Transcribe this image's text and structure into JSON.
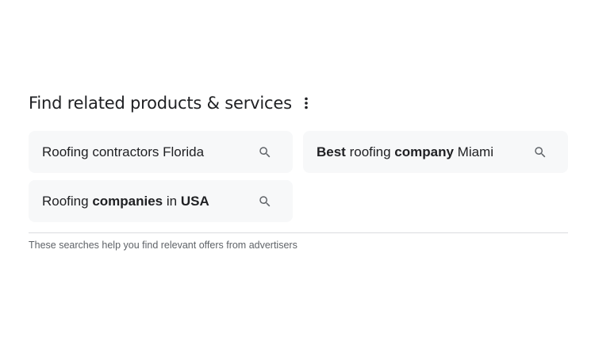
{
  "section": {
    "title": "Find related products & services",
    "more_icon": "more-vert-icon",
    "footer": "These searches help you find relevant offers from advertisers"
  },
  "suggestions": [
    {
      "parts": [
        {
          "text": "Roofing contractors Florida",
          "bold": false
        }
      ],
      "icon": "search-icon"
    },
    {
      "parts": [
        {
          "text": "Best",
          "bold": true
        },
        {
          "text": " roofing ",
          "bold": false
        },
        {
          "text": "company",
          "bold": true
        },
        {
          "text": " Miami",
          "bold": false
        }
      ],
      "icon": "search-icon"
    },
    {
      "parts": [
        {
          "text": "Roofing ",
          "bold": false
        },
        {
          "text": "companies",
          "bold": true
        },
        {
          "text": " in ",
          "bold": false
        },
        {
          "text": "USA",
          "bold": true
        }
      ],
      "icon": "search-icon"
    }
  ],
  "colors": {
    "chip_background": "#f7f8f9",
    "text": "#202124",
    "muted_text": "#5f6368",
    "icon": "#5f6368",
    "divider": "#dadce0"
  }
}
